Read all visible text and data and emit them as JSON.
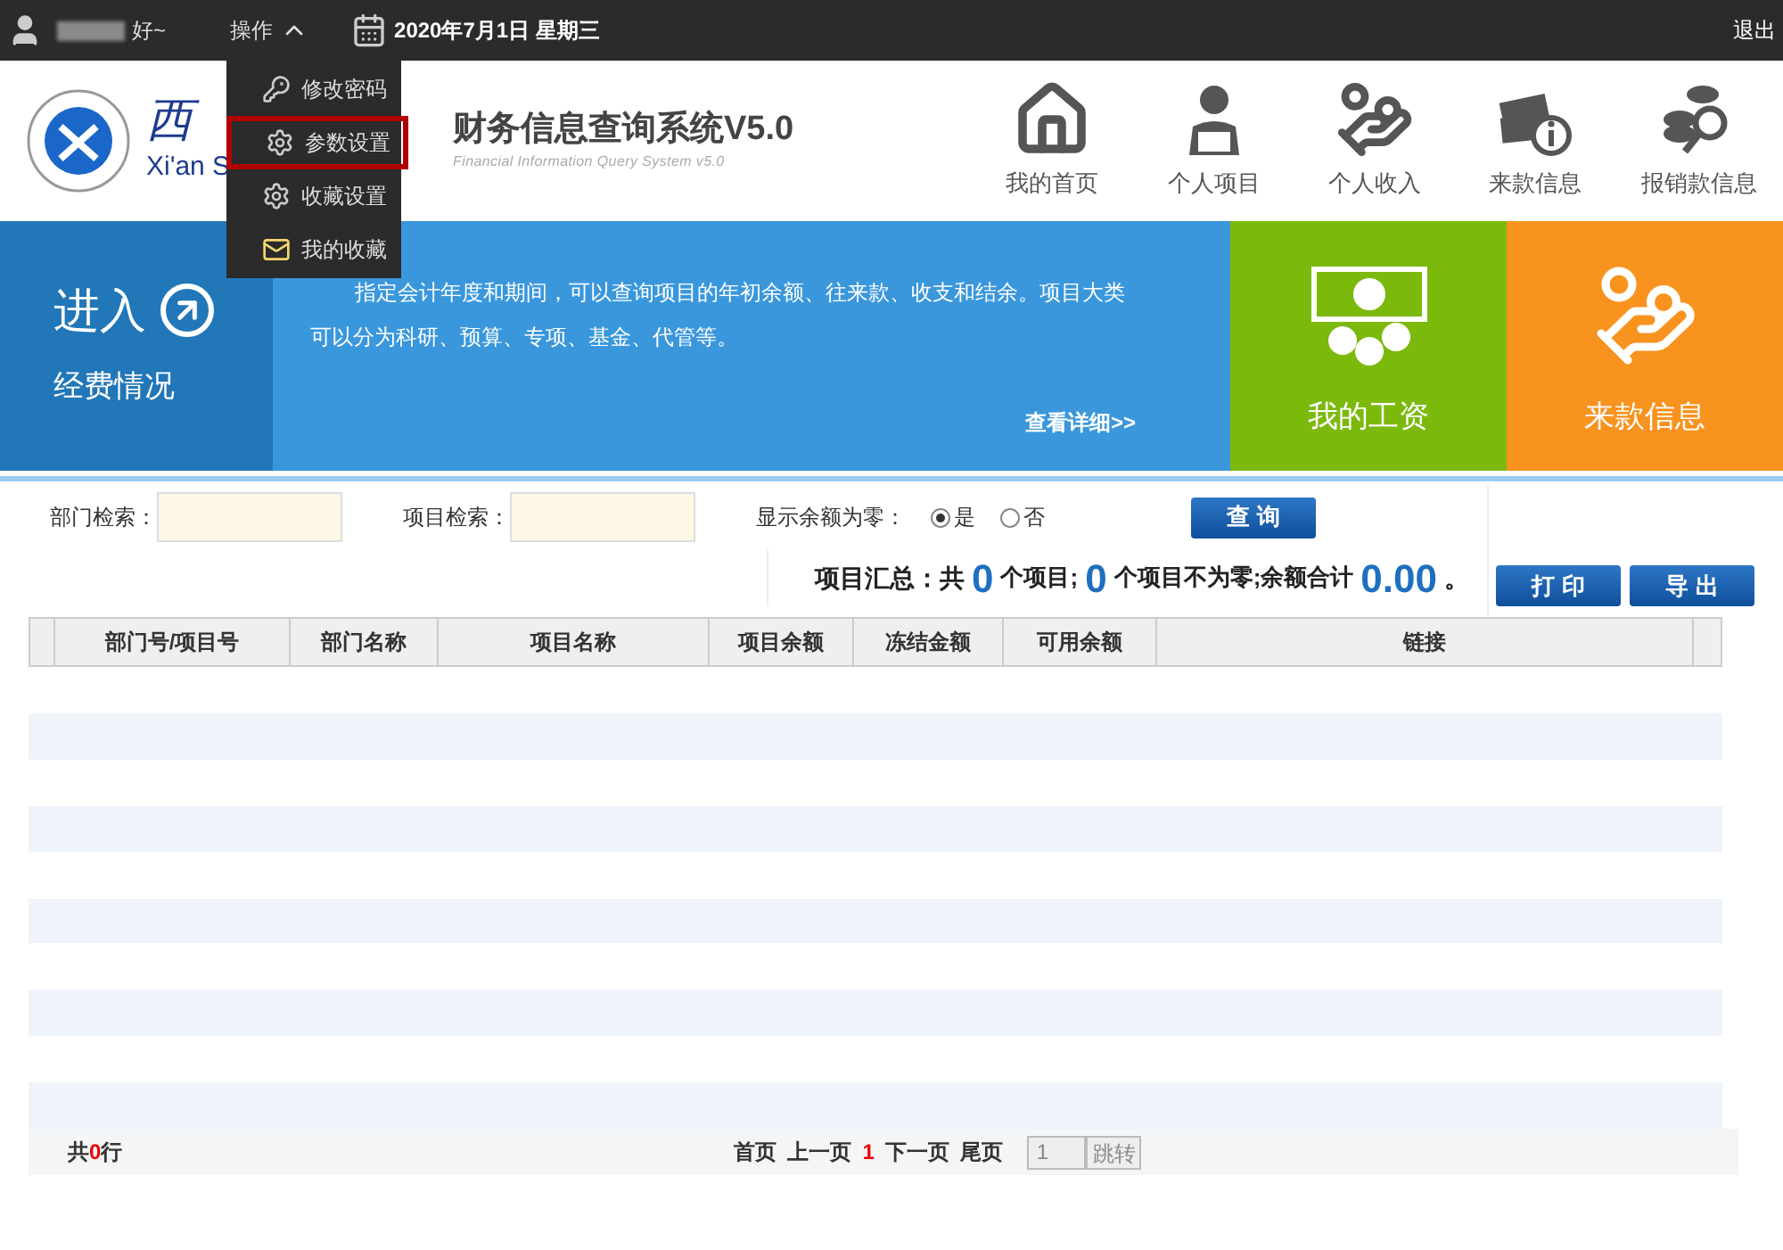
{
  "top_bar": {
    "user_suffix": "好~",
    "menu_label": "操作",
    "date": "2020年7月1日 星期三",
    "logout": "退出"
  },
  "dropdown": {
    "items": [
      {
        "label": "修改密码",
        "kind": "key",
        "selected": false
      },
      {
        "label": "参数设置",
        "kind": "gear",
        "selected": true
      },
      {
        "label": "收藏设置",
        "kind": "gear",
        "selected": false
      },
      {
        "label": "我的收藏",
        "kind": "envelope",
        "selected": false
      }
    ]
  },
  "header": {
    "logo_script": "西",
    "logo_latin": "Xi'an S",
    "title": "财务信息查询系统V5.0",
    "subtitle": "Financial Information Query System  v5.0",
    "nav": [
      {
        "label": "我的首页",
        "kind": "home"
      },
      {
        "label": "个人项目",
        "kind": "person"
      },
      {
        "label": "个人收入",
        "kind": "hand"
      },
      {
        "label": "来款信息",
        "kind": "money"
      },
      {
        "label": "报销款信息",
        "kind": "coins"
      }
    ]
  },
  "banner": {
    "enter": "进入",
    "section": "经费情况",
    "description": "指定会计年度和期间，可以查询项目的年初余额、往来款、收支和结余。项目大类可以分为科研、预算、专项、基金、代管等。",
    "more": "查看详细>>",
    "tiles": [
      {
        "label": "我的工资",
        "kind": "salary",
        "color": "#7cb90d"
      },
      {
        "label": "来款信息",
        "kind": "hand",
        "color": "#f8931f"
      }
    ]
  },
  "filters": {
    "dept_label": "部门检索：",
    "project_label": "项目检索：",
    "zero_label": "显示余额为零：",
    "options": [
      {
        "label": "是",
        "selected": true
      },
      {
        "label": "否",
        "selected": false
      }
    ],
    "query": "查 询"
  },
  "summary": {
    "prefix": "项目汇总：共",
    "count": "0",
    "mid": "个项目;",
    "nonzero": "0",
    "mid2": "个项目不为零;余额合计",
    "total": "0.00",
    "end": "。"
  },
  "actions": [
    "打 印",
    "导 出"
  ],
  "table": {
    "columns": [
      "部门号/项目号",
      "部门名称",
      "项目名称",
      "项目余额",
      "冻结金额",
      "可用余额",
      "链接"
    ]
  },
  "footer": {
    "rows_prefix": "共",
    "rows_count": "0",
    "rows_suffix": "行",
    "first": "首页",
    "prev": "上一页",
    "page": "1",
    "next": "下一页",
    "last": "尾页",
    "page_input": "1",
    "go": "跳转"
  }
}
